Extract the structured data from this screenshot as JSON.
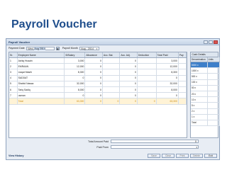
{
  "slide": {
    "title": "Payroll Voucher"
  },
  "window": {
    "title": "Payroll Voucher"
  },
  "filters": {
    "payment_date_label": "Payment Date",
    "payment_date_day": "Wed,",
    "payment_date_month": "Aug 2014",
    "payroll_month_label": "Payroll Month",
    "payroll_month_value": "Aug - 2014"
  },
  "grid": {
    "columns": [
      "Sr.",
      "Employee Name",
      "B/Salary",
      "Allowance",
      "Acc. Bal.",
      "Acc. Adj.",
      "Deduction",
      "Total Paid",
      "Pay"
    ],
    "rows": [
      [
        "1",
        "Ashiq Husain",
        "3,000",
        "0",
        "",
        "0",
        "",
        "3,000",
        ""
      ],
      [
        "2",
        "EMRAAN",
        "12,000",
        "0",
        "",
        "0",
        "",
        "12,000",
        ""
      ],
      [
        "3",
        "Liaqat Masih",
        "8,300",
        "0",
        "",
        "0",
        "",
        "8,300",
        ""
      ],
      [
        "4",
        "SADDAT",
        "0",
        "0",
        "",
        "0",
        "",
        "0",
        ""
      ],
      [
        "5",
        "Shahid Nawaz",
        "32,000",
        "0",
        "",
        "0",
        "",
        "32,000",
        ""
      ],
      [
        "6",
        "Tariq Sadiq",
        "8,000",
        "0",
        "",
        "0",
        "",
        "8,000",
        ""
      ],
      [
        "7",
        "usman",
        "0",
        "0",
        "",
        "0",
        "",
        "0",
        ""
      ]
    ],
    "total_row": [
      "",
      "Total",
      "63,300",
      "0",
      "0",
      "0",
      "0",
      "63,300",
      ""
    ]
  },
  "cash": {
    "title": "Cash Details",
    "columns": [
      "Denomination",
      "Units"
    ],
    "rows": [
      "5000 x",
      "1000 x",
      "500 x",
      "100 x",
      "50 x",
      "20 x",
      "10 x",
      "5 x",
      "2 x",
      "1 x",
      "Total"
    ]
  },
  "bottom": {
    "total_amount_paid_label": "Total Amount Paid",
    "total_amount_paid_value": "0",
    "paid_from_label": "Paid From",
    "view_history": "View History",
    "buttons": {
      "save": "Save",
      "clear": "Clear",
      "print": "Print",
      "delete": "Delete",
      "exit": "Exit"
    }
  }
}
